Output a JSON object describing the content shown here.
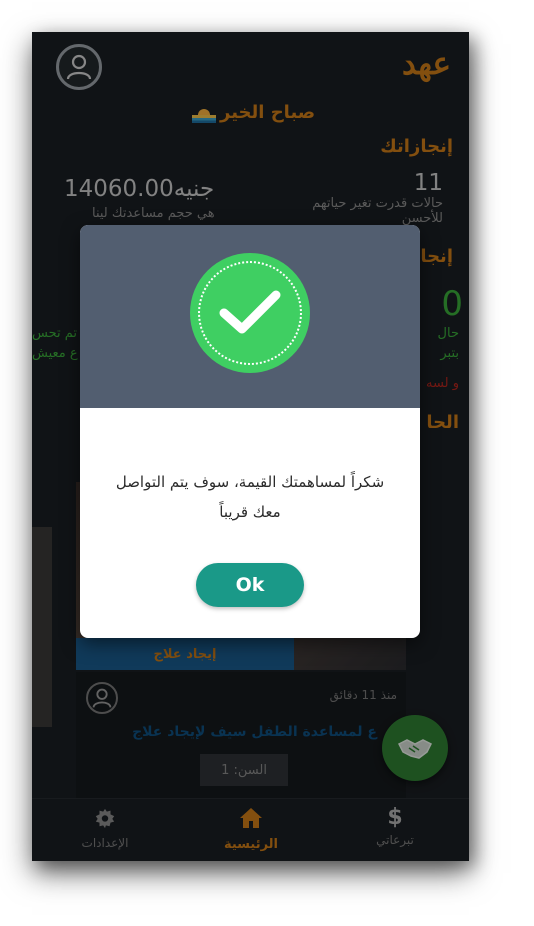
{
  "app": {
    "brand": "عهد",
    "greeting": "صباح الخير"
  },
  "achievements": {
    "title": "إنجازاتك",
    "cases_count": "11",
    "cases_label": "حالات قدرت تغير حياتهم للأحسن",
    "amount": "14060.00",
    "currency": "جنيه",
    "amount_label": "هي حجم مساعدتك لينا"
  },
  "section2": {
    "title_partial": "إنجا",
    "big_value": "0",
    "line1": "حال",
    "line2": "بتبر",
    "red_line": "و لسه"
  },
  "section3": {
    "title_partial": "الحا"
  },
  "left_fragments": {
    "line1": "تم تحس",
    "line2": "ع معيش"
  },
  "card": {
    "tag": "إيجاد علاج",
    "time": "منذ 11 دقائق",
    "title": "ع لمساعدة الطفل سيف لإيجاد علاج",
    "age": "السن: 1"
  },
  "bottom_nav": {
    "settings": "الإعدادات",
    "home": "الرئيسية",
    "donations": "تبرعاتي"
  },
  "dialog": {
    "message": "شكراً لمساهمتك القيمة، سوف يتم التواصل معك قريباً",
    "ok_label": "Ok"
  },
  "colors": {
    "accent": "#c97a17",
    "success": "#3fcf62",
    "button": "#1a9988",
    "dialog_header": "#525e70"
  }
}
